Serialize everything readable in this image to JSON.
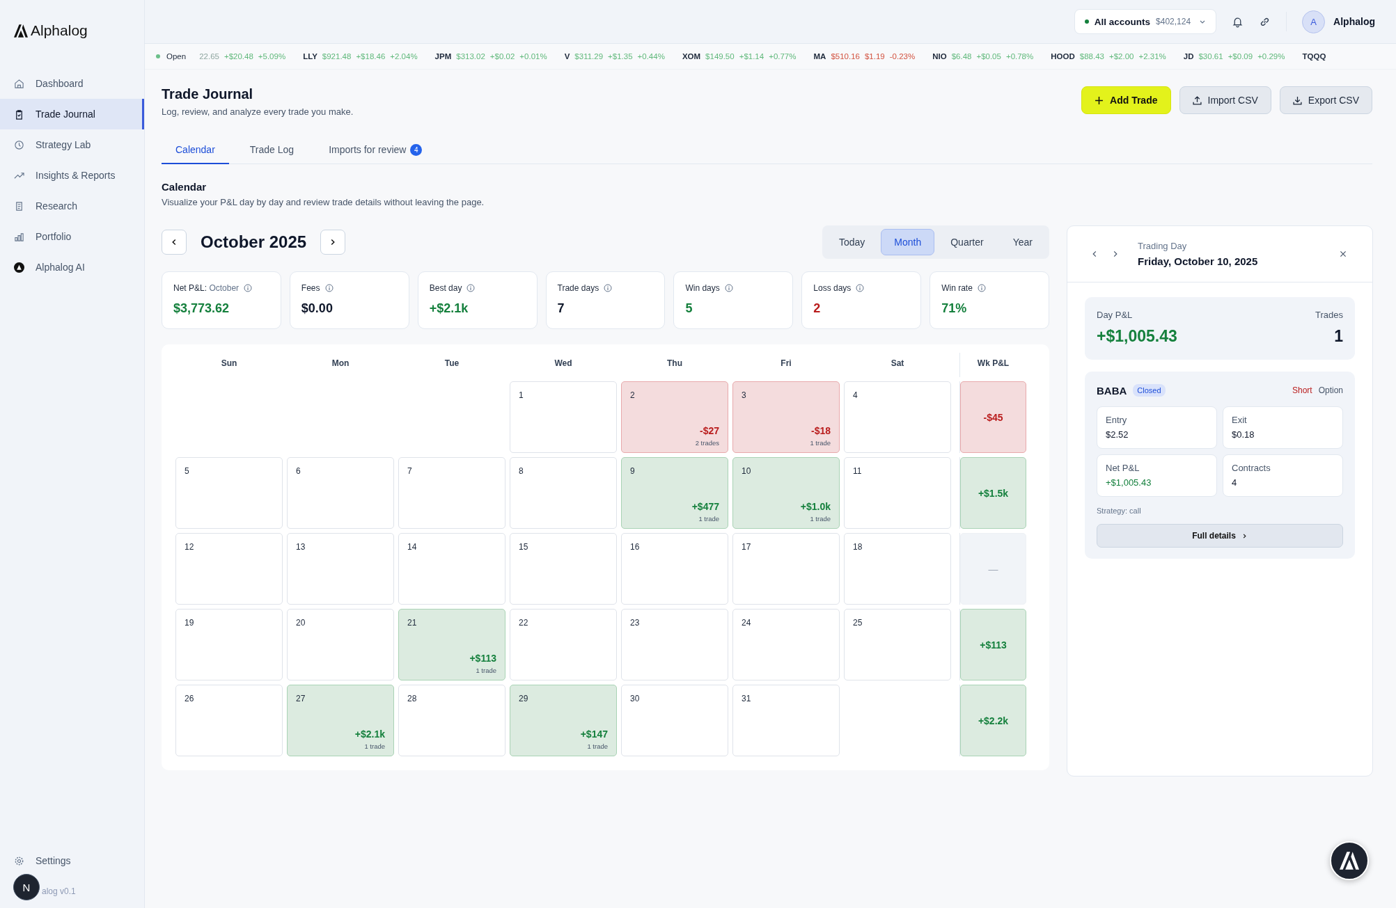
{
  "brand": {
    "name": "Alphalog"
  },
  "sidebar": {
    "items": [
      {
        "label": "Dashboard",
        "selected": false
      },
      {
        "label": "Trade Journal",
        "selected": true
      },
      {
        "label": "Strategy Lab",
        "selected": false
      },
      {
        "label": "Insights & Reports",
        "selected": false
      },
      {
        "label": "Research",
        "selected": false
      },
      {
        "label": "Portfolio",
        "selected": false
      },
      {
        "label": "Alphalog AI",
        "selected": false
      }
    ],
    "settings": "Settings",
    "version": "alog v0.1",
    "user_badge": "N"
  },
  "topbar": {
    "account": {
      "label": "All accounts",
      "balance": "$402,124"
    },
    "user": {
      "initial": "A",
      "name": "Alphalog"
    }
  },
  "ticker": {
    "status": "Open",
    "items": [
      {
        "price": "22.65",
        "change": "+$20.48",
        "pct": "+5.09%",
        "kind": "up"
      },
      {
        "symbol": "LLY",
        "price": "$921.48",
        "change": "+$18.46",
        "pct": "+2.04%",
        "kind": "up"
      },
      {
        "symbol": "JPM",
        "price": "$313.02",
        "change": "+$0.02",
        "pct": "+0.01%",
        "kind": "up"
      },
      {
        "symbol": "V",
        "price": "$311.29",
        "change": "+$1.35",
        "pct": "+0.44%",
        "kind": "up"
      },
      {
        "symbol": "XOM",
        "price": "$149.50",
        "change": "+$1.14",
        "pct": "+0.77%",
        "kind": "up"
      },
      {
        "symbol": "MA",
        "price": "$510.16",
        "change": "$1.19",
        "pct": "-0.23%",
        "kind": "down"
      },
      {
        "symbol": "NIO",
        "price": "$6.48",
        "change": "+$0.05",
        "pct": "+0.78%",
        "kind": "up"
      },
      {
        "symbol": "HOOD",
        "price": "$88.43",
        "change": "+$2.00",
        "pct": "+2.31%",
        "kind": "up"
      },
      {
        "symbol": "JD",
        "price": "$30.61",
        "change": "+$0.09",
        "pct": "+0.29%",
        "kind": "up"
      },
      {
        "symbol": "TQQQ"
      }
    ]
  },
  "page": {
    "title": "Trade Journal",
    "subtitle": "Log, review, and analyze every trade you make.",
    "actions": [
      {
        "label": "Add Trade",
        "kind": "primary"
      },
      {
        "label": "Import CSV",
        "kind": "secondary"
      },
      {
        "label": "Export CSV",
        "kind": "secondary"
      }
    ]
  },
  "tabs": [
    {
      "label": "Calendar",
      "selected": true
    },
    {
      "label": "Trade Log",
      "selected": false
    },
    {
      "label": "Imports for review",
      "selected": false,
      "badge": "4"
    }
  ],
  "calendar": {
    "title": "Calendar",
    "subtitle": "Visualize your P&L day by day and review trade details without leaving the page.",
    "month": "October 2025",
    "ranges": [
      {
        "label": "Today",
        "selected": false
      },
      {
        "label": "Month",
        "selected": true
      },
      {
        "label": "Quarter",
        "selected": false
      },
      {
        "label": "Year",
        "selected": false
      }
    ],
    "stats": [
      {
        "label": "Net P&L:",
        "suffix": "October",
        "value": "$3,773.62",
        "kind": "win"
      },
      {
        "label": "Fees",
        "value": "$0.00",
        "kind": "neutral"
      },
      {
        "label": "Best day",
        "value": "+$2.1k",
        "kind": "win"
      },
      {
        "label": "Trade days",
        "value": "7",
        "kind": "neutral"
      },
      {
        "label": "Win days",
        "value": "5",
        "kind": "win"
      },
      {
        "label": "Loss days",
        "value": "2",
        "kind": "loss"
      },
      {
        "label": "Win rate",
        "value": "71%",
        "kind": "win"
      }
    ],
    "weekdays": [
      "Sun",
      "Mon",
      "Tue",
      "Wed",
      "Thu",
      "Fri",
      "Sat"
    ],
    "week_total_header": "Wk P&L",
    "weeks": [
      {
        "days": [
          {
            "day": "1"
          },
          {
            "day": "2",
            "pnl": "-$27",
            "trades": "2 trades",
            "kind": "loss"
          },
          {
            "day": "3",
            "pnl": "-$18",
            "trades": "1 trade",
            "kind": "loss"
          },
          {
            "day": "4"
          }
        ],
        "total": {
          "value": "-$45",
          "kind": "loss"
        }
      },
      {
        "days": [
          {
            "day": "5"
          },
          {
            "day": "6"
          },
          {
            "day": "7"
          },
          {
            "day": "8"
          },
          {
            "day": "9",
            "pnl": "+$477",
            "trades": "1 trade",
            "kind": "win"
          },
          {
            "day": "10",
            "pnl": "+$1.0k",
            "trades": "1 trade",
            "kind": "win"
          },
          {
            "day": "11"
          }
        ],
        "total": {
          "value": "+$1.5k",
          "kind": "win"
        }
      },
      {
        "days": [
          {
            "day": "12"
          },
          {
            "day": "13"
          },
          {
            "day": "14"
          },
          {
            "day": "15"
          },
          {
            "day": "16"
          },
          {
            "day": "17"
          },
          {
            "day": "18"
          }
        ],
        "total": {
          "value": "—",
          "kind": "neutral"
        }
      },
      {
        "days": [
          {
            "day": "19"
          },
          {
            "day": "20"
          },
          {
            "day": "21",
            "pnl": "+$113",
            "trades": "1 trade",
            "kind": "win"
          },
          {
            "day": "22"
          },
          {
            "day": "23"
          },
          {
            "day": "24"
          },
          {
            "day": "25"
          }
        ],
        "total": {
          "value": "+$113",
          "kind": "win"
        }
      },
      {
        "days": [
          {
            "day": "26"
          },
          {
            "day": "27",
            "pnl": "+$2.1k",
            "trades": "1 trade",
            "kind": "win"
          },
          {
            "day": "28"
          },
          {
            "day": "29",
            "pnl": "+$147",
            "trades": "1 trade",
            "kind": "win"
          },
          {
            "day": "30"
          },
          {
            "day": "31"
          }
        ],
        "total": {
          "value": "+$2.2k",
          "kind": "win"
        }
      }
    ]
  },
  "day_panel": {
    "label": "Trading Day",
    "date": "Friday, October 10, 2025",
    "pnl_label": "Day P&L",
    "pnl": "+$1,005.43",
    "trades_label": "Trades",
    "trades": "1",
    "trade": {
      "symbol": "BABA",
      "status": "Closed",
      "side": "Short",
      "type": "Option",
      "fields": [
        {
          "label": "Entry",
          "value": "$2.52",
          "kind": "neutral"
        },
        {
          "label": "Exit",
          "value": "$0.18",
          "kind": "neutral"
        },
        {
          "label": "Net P&L",
          "value": "+$1,005.43",
          "kind": "win"
        },
        {
          "label": "Contracts",
          "value": "4",
          "kind": "neutral"
        }
      ],
      "strategy": "Strategy: call",
      "button": "Full details"
    }
  }
}
